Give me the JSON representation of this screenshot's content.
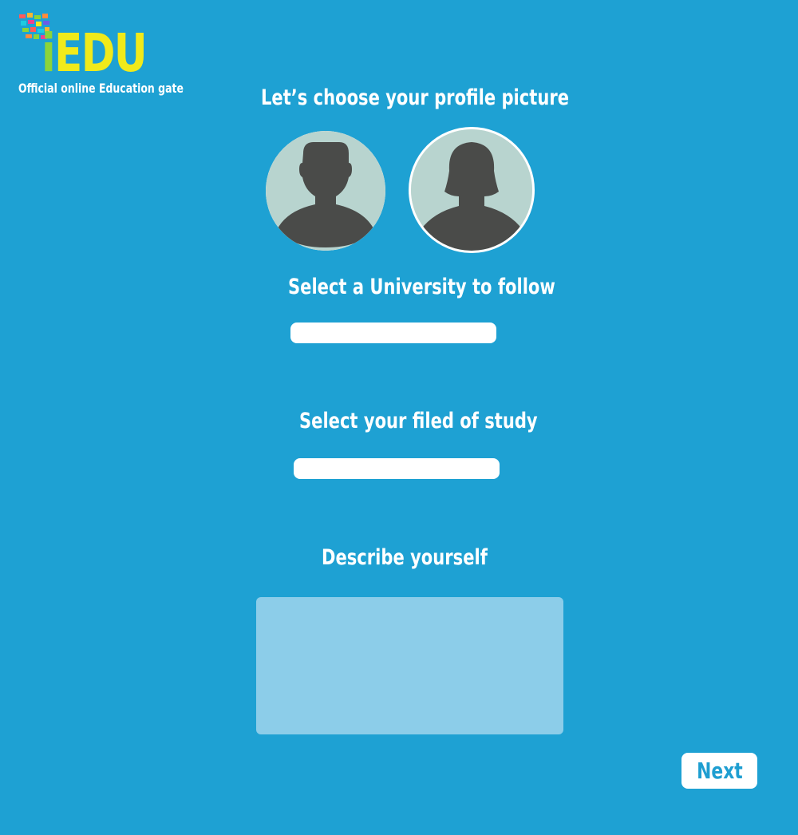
{
  "brand": {
    "logo_icon": "puzzle-brain-icon",
    "name_i": "i",
    "name_rest": "EDU",
    "tagline": "Official online Education gate",
    "colors": {
      "i": "#8bd43a",
      "edu": "#f0ea1a"
    }
  },
  "profile": {
    "heading": "Let’s choose your profile picture",
    "avatars": [
      {
        "icon": "male-avatar-icon",
        "selected": true
      },
      {
        "icon": "female-avatar-icon",
        "selected": false
      }
    ]
  },
  "university": {
    "heading": "Select a University to follow",
    "value": "",
    "placeholder": ""
  },
  "field": {
    "heading": "Select your filed of study",
    "value": "",
    "placeholder": ""
  },
  "describe": {
    "heading": "Describe yourself",
    "value": "",
    "placeholder": ""
  },
  "actions": {
    "next_label": "Next"
  },
  "colors": {
    "background": "#1ea1d3",
    "avatar_bg": "#b8d4cf",
    "avatar_silhouette": "#4a4b49",
    "textarea_bg": "#8ccde9",
    "accent": "#1e9ed1"
  }
}
